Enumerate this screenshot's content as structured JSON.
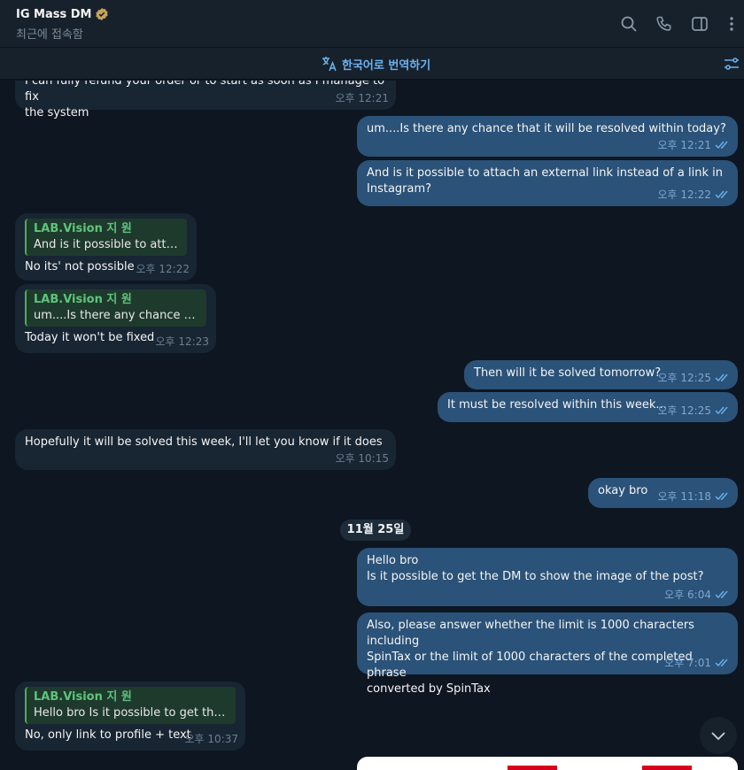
{
  "header": {
    "title": "IG Mass DM",
    "status": "최근에 접속함",
    "icons": [
      "verified-icon",
      "search-icon",
      "phone-icon",
      "sidebar-icon",
      "more-icon"
    ]
  },
  "translate_bar": {
    "label": "한국어로 번역하기",
    "icons": [
      "translate-icon",
      "filter-icon"
    ]
  },
  "colors": {
    "background": "#0e1621",
    "incoming_bubble": "#182533",
    "outgoing_bubble": "#2b5278",
    "reply_name": "#5fc47b",
    "accent": "#6ab2f2"
  },
  "messages": [
    {
      "id": "m1",
      "text": "I can fully refund your order or to start as soon as I manage to fix\nthe system",
      "time": "오후 12:21"
    },
    {
      "id": "m2",
      "text": "um....Is there any chance that it will be resolved within today?",
      "time": "오후 12:21"
    },
    {
      "id": "m3",
      "text": "And is it possible to attach an external link instead of a link in\nInstagram?",
      "time": "오후 12:22"
    },
    {
      "id": "m4",
      "reply_name": "LAB.Vision 지 원",
      "reply_text": "And is it possible to attach...",
      "text": "No its' not possible",
      "time": "오후 12:22"
    },
    {
      "id": "m5",
      "reply_name": "LAB.Vision 지 원",
      "reply_text": "um....Is there any chance that ...",
      "text": "Today it won't be fixed",
      "time": "오후 12:23"
    },
    {
      "id": "m6",
      "text": "Then will it be solved tomorrow?",
      "time": "오후 12:25"
    },
    {
      "id": "m7",
      "text": "It must be resolved within this week...",
      "time": "오후 12:25"
    },
    {
      "id": "m8",
      "text": "Hopefully it will be solved this week, I'll let you know if it does",
      "time": "오후 10:15"
    },
    {
      "id": "m9",
      "text": "okay bro",
      "time": "오후 11:18"
    },
    {
      "id": "m10",
      "text": "Hello bro\nIs it possible to get the DM to show the image of the post?",
      "time": "오후 6:04"
    },
    {
      "id": "m11",
      "text": "Also, please answer whether the limit is 1000 characters including\nSpinTax or the limit of 1000 characters of the completed phrase\nconverted by SpinTax",
      "time": "오후 7:01"
    },
    {
      "id": "m12",
      "reply_name": "LAB.Vision 지 원",
      "reply_text": "Hello bro Is it possible to get the D...",
      "text": "No, only link to profile + text",
      "time": "오후 10:37"
    }
  ],
  "date_separator": "11월 25일",
  "scroll_button_icon": "chevron-down-icon"
}
